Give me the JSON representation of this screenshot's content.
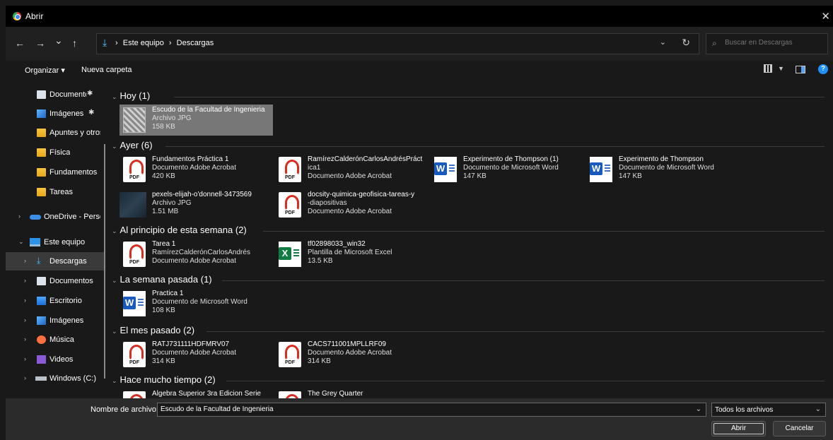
{
  "window": {
    "title": "Abrir",
    "close_glyph": "✕"
  },
  "nav": {
    "back_glyph": "←",
    "forward_glyph": "→",
    "recent_glyph": "⌄",
    "up_glyph": "↑",
    "address_icon": "download-arrow-icon",
    "breadcrumb": [
      "Este equipo",
      "Descargas"
    ],
    "separator": "›",
    "refresh_glyph": "↻",
    "search_placeholder": "Buscar en Descargas"
  },
  "toolbar": {
    "organize_label": "Organizar ▾",
    "new_folder_label": "Nueva carpeta",
    "help_glyph": "?"
  },
  "sidebar": {
    "items": [
      {
        "label": "Documento",
        "pinned": true
      },
      {
        "label": "Imágenes",
        "pinned": true
      },
      {
        "label": "Apuntes y otros"
      },
      {
        "label": "Física"
      },
      {
        "label": "Fundamentos d"
      },
      {
        "label": "Tareas"
      },
      {
        "label": "OneDrive - Perso"
      },
      {
        "label": "Este equipo"
      },
      {
        "label": "Descargas"
      },
      {
        "label": "Documentos"
      },
      {
        "label": "Escritorio"
      },
      {
        "label": "Imágenes"
      },
      {
        "label": "Música"
      },
      {
        "label": "Videos"
      },
      {
        "label": "Windows (C:)"
      }
    ]
  },
  "groups": [
    {
      "title": "Hoy (1)"
    },
    {
      "title": "Ayer (6)"
    },
    {
      "title": "Al principio de esta semana (2)"
    },
    {
      "title": "La semana pasada (1)"
    },
    {
      "title": "El mes pasado (2)"
    },
    {
      "title": "Hace mucho tiempo (2)"
    }
  ],
  "files": [
    {
      "name": "Escudo de la Facultad de Ingenieria",
      "type": "Archivo JPG",
      "size": "158 KB",
      "icon": "crest-thumbnail"
    },
    {
      "name": "Fundamentos Práctica 1",
      "type": "Documento Adobe Acrobat",
      "size": "420 KB",
      "icon": "pdf-icon"
    },
    {
      "name": "RamírezCalderónCarlosAndrésPráct",
      "name2": "ica1",
      "type": "Documento Adobe Acrobat",
      "icon": "pdf-icon"
    },
    {
      "name": "Experimento de Thompson (1)",
      "type": "Documento de Microsoft Word",
      "size": "147 KB",
      "icon": "word-icon"
    },
    {
      "name": "Experimento de Thompson",
      "type": "Documento de Microsoft Word",
      "size": "147 KB",
      "icon": "word-icon"
    },
    {
      "name": "pexels-elijah-o'donnell-3473569",
      "type": "Archivo JPG",
      "size": "1.51 MB",
      "icon": "image-thumbnail"
    },
    {
      "name": "docsity-quimica-geofisica-tareas-y",
      "name2": "-diapositivas",
      "type": "Documento Adobe Acrobat",
      "icon": "pdf-icon"
    },
    {
      "name": "Tarea 1",
      "name2": "RamírezCalderónCarlosAndrés",
      "type": "Documento Adobe Acrobat",
      "icon": "pdf-icon"
    },
    {
      "name": "tf02898033_win32",
      "type": "Plantilla de Microsoft Excel",
      "size": "13.5 KB",
      "icon": "excel-icon"
    },
    {
      "name": "Practica 1",
      "type": "Documento de Microsoft Word",
      "size": "108 KB",
      "icon": "word-icon"
    },
    {
      "name": "RATJ731111HDFMRV07",
      "type": "Documento Adobe Acrobat",
      "size": "314 KB",
      "icon": "pdf-icon"
    },
    {
      "name": "CACS711001MPLLRF09",
      "type": "Documento Adobe Acrobat",
      "size": "314 KB",
      "icon": "pdf-icon"
    },
    {
      "name": "Algebra Superior 3ra Edicion Serie",
      "icon": "pdf-icon"
    },
    {
      "name": "The Grey Quarter",
      "icon": "pdf-icon"
    }
  ],
  "footer": {
    "filename_label": "Nombre de archivo:",
    "filename_value": "Escudo de la Facultad de Ingenieria",
    "filetype_value": "Todos los archivos",
    "open_label": "Abrir",
    "cancel_label": "Cancelar"
  },
  "colors": {
    "accent": "#4cc2ff",
    "background": "#191919",
    "selection": "#777777"
  }
}
